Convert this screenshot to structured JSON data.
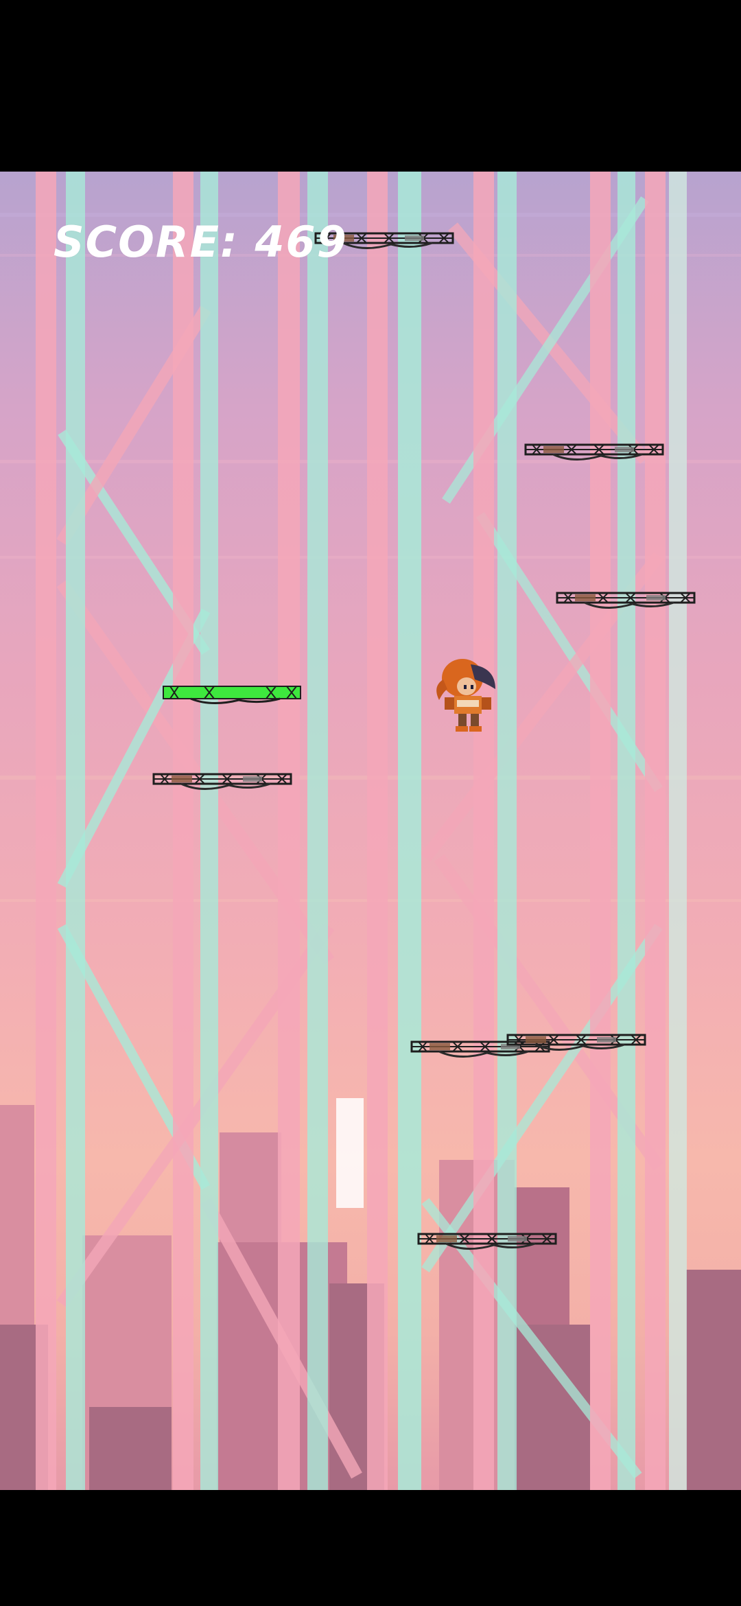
{
  "hud": {
    "score_label": "SCORE: 469"
  },
  "icons": {
    "player": "girl-character-icon",
    "platform": "metal-girder-platform",
    "bonus_platform": "green-girder-platform"
  },
  "colors": {
    "sky_top": "#b7a3cf",
    "sky_bottom": "#f3b0a8",
    "girder_pink": "#f4a7b8",
    "girder_teal": "#a8ead8",
    "platform_dark": "#2a2a2a",
    "platform_green": "#3ee83e",
    "player_hair": "#d9661e"
  }
}
